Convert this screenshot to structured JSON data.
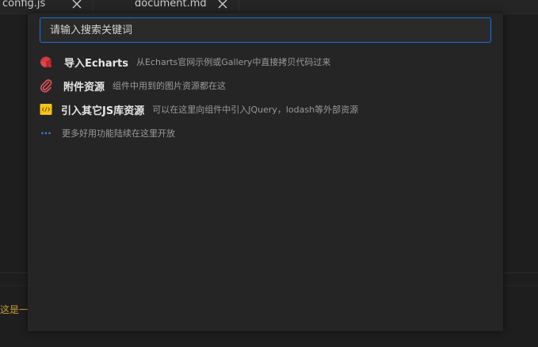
{
  "tabs": [
    {
      "label": "config.js"
    },
    {
      "label": "document.md"
    }
  ],
  "search": {
    "placeholder": "请输入搜索关键词",
    "value": ""
  },
  "menu": {
    "items": [
      {
        "title": "导入Echarts",
        "desc": "从Echarts官网示例或Gallery中直接拷贝代码过来",
        "icon": "echarts-icon"
      },
      {
        "title": "附件资源",
        "desc": "组件中用到的图片资源都在这",
        "icon": "paperclip-icon"
      },
      {
        "title": "引入其它JS库资源",
        "desc": "可以在这里向组件中引入JQuery，lodash等外部资源",
        "icon": "js-file-icon"
      }
    ],
    "more": {
      "text": "更多好用功能陆续在这里开放",
      "icon": "ellipsis-icon"
    }
  },
  "editor": {
    "line_text": "这是一"
  },
  "colors": {
    "accent": "#1f6fcf",
    "echarts": "#d9383e",
    "paperclip": "#e0505a",
    "js_badge": "#f5c518",
    "ellipsis": "#3b82d6",
    "editor_text": "#c89d36"
  }
}
